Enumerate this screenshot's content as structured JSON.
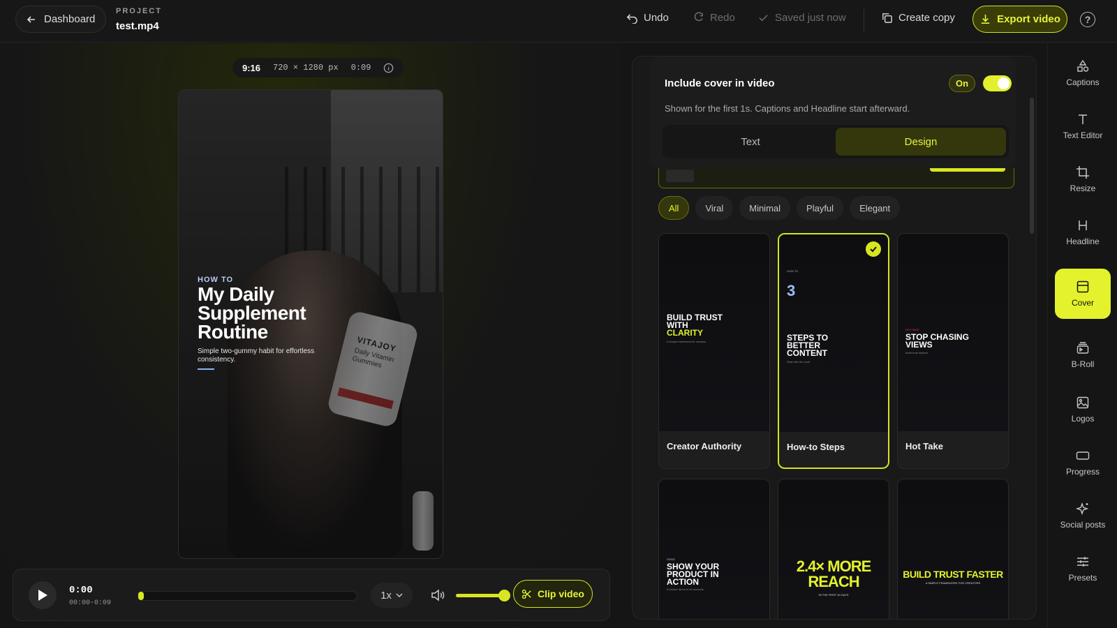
{
  "topbar": {
    "back_label": "Dashboard",
    "project_label": "PROJECT",
    "project_name": "test.mp4",
    "undo": "Undo",
    "redo": "Redo",
    "saved_status": "Saved just now",
    "create_copy": "Create copy",
    "export": "Export video",
    "help": "?"
  },
  "preview": {
    "aspect_ratio": "9:16",
    "dimensions": "720 × 1280 px",
    "duration": "0:09",
    "overlay": {
      "eyebrow": "HOW TO",
      "title": "My Daily Supplement Routine",
      "subtitle": "Simple two-gummy habit for effortless consistency."
    },
    "bottle": {
      "brand": "VITAJOY",
      "label": "Daily Vitamin Gummies"
    }
  },
  "player": {
    "current_time": "0:00",
    "range": "00:00-0:09",
    "progress": 0.01,
    "speed": "1x",
    "volume": 1.0,
    "clip_label": "Clip video"
  },
  "cover_panel": {
    "title": "Include cover in video",
    "state_label": "On",
    "enabled": true,
    "description": "Shown for the first 1s. Captions and Headline start afterward.",
    "tabs": [
      "Text",
      "Design"
    ],
    "active_tab": "Design",
    "filters": [
      "All",
      "Viral",
      "Minimal",
      "Playful",
      "Elegant"
    ],
    "active_filter": "All",
    "templates": [
      {
        "name": "Creator Authority",
        "preview_lines": [
          "BUILD TRUST",
          "WITH",
          "CLARITY"
        ],
        "preview_small": "A simple framework for creators",
        "selected": false
      },
      {
        "name": "How-to Steps",
        "preview_eyebrow": "HOW TO",
        "preview_number": "3",
        "preview_lines": [
          "STEPS TO",
          "BETTER",
          "CONTENT"
        ],
        "preview_small": "Start with the hook",
        "selected": true
      },
      {
        "name": "Hot Take",
        "preview_eyebrow": "HOT TAKE",
        "preview_lines": [
          "STOP CHASING",
          "VIEWS"
        ],
        "preview_small": "Build trust instead",
        "selected": false
      },
      {
        "name": "",
        "preview_eyebrow": "DEMO",
        "preview_lines": [
          "SHOW YOUR",
          "PRODUCT IN",
          "ACTION"
        ],
        "preview_small": "A clearer demo in 60 seconds",
        "selected": false
      },
      {
        "name": "",
        "preview_lines": [
          "2.4× MORE",
          "REACH"
        ],
        "preview_small": "IN THE FIRST 30 DAYS",
        "selected": false
      },
      {
        "name": "",
        "preview_lines": [
          "BUILD TRUST FASTER"
        ],
        "preview_small": "A SIMPLE FRAMEWORK FOR CREATORS",
        "selected": false
      }
    ]
  },
  "sidebar": {
    "items": [
      {
        "label": "Captions",
        "icon": "shapes-icon"
      },
      {
        "label": "Text Editor",
        "icon": "text-icon"
      },
      {
        "label": "Resize",
        "icon": "crop-icon"
      },
      {
        "label": "Headline",
        "icon": "heading-icon"
      },
      {
        "label": "Cover",
        "icon": "cover-icon",
        "active": true
      },
      {
        "label": "B-Roll",
        "icon": "broll-icon"
      },
      {
        "label": "Logos",
        "icon": "image-icon"
      },
      {
        "label": "Progress",
        "icon": "progress-icon"
      },
      {
        "label": "Social posts",
        "icon": "sparkle-icon"
      },
      {
        "label": "Presets",
        "icon": "sliders-icon"
      }
    ]
  },
  "colors": {
    "accent": "#e3f22c",
    "accent_dark": "#34370c",
    "background": "#151515"
  }
}
